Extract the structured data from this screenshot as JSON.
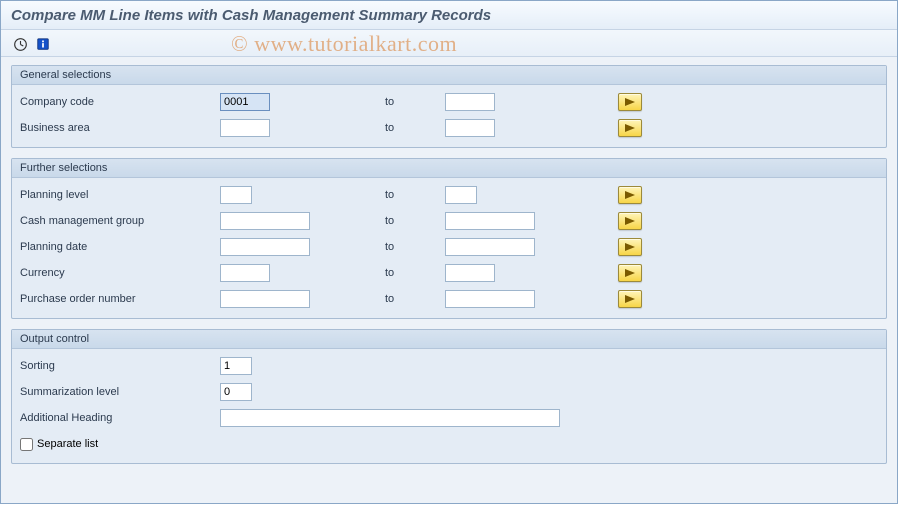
{
  "title": "Compare MM Line Items with Cash Management Summary Records",
  "watermark": "© www.tutorialkart.com",
  "to_label": "to",
  "sections": {
    "general": {
      "title": "General selections",
      "company_code": {
        "label": "Company code",
        "from": "0001",
        "to": ""
      },
      "business_area": {
        "label": "Business area",
        "from": "",
        "to": ""
      }
    },
    "further": {
      "title": "Further selections",
      "planning_level": {
        "label": "Planning level",
        "from": "",
        "to": ""
      },
      "cm_group": {
        "label": "Cash management group",
        "from": "",
        "to": ""
      },
      "planning_date": {
        "label": "Planning date",
        "from": "",
        "to": ""
      },
      "currency": {
        "label": "Currency",
        "from": "",
        "to": ""
      },
      "po_number": {
        "label": "Purchase order number",
        "from": "",
        "to": ""
      }
    },
    "output": {
      "title": "Output control",
      "sorting": {
        "label": "Sorting",
        "value": "1"
      },
      "summarization": {
        "label": "Summarization level",
        "value": "0"
      },
      "additional_heading": {
        "label": "Additional Heading",
        "value": ""
      },
      "separate_list": {
        "label": "Separate list",
        "checked": false
      }
    }
  }
}
